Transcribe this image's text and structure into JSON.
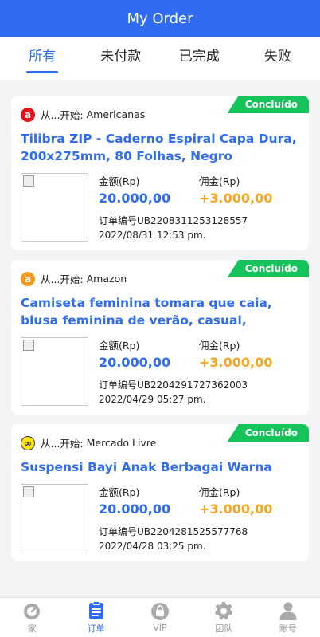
{
  "header": {
    "title": "My Order"
  },
  "tabs": [
    {
      "label": "所有"
    },
    {
      "label": "未付款"
    },
    {
      "label": "已完成"
    },
    {
      "label": "失败"
    }
  ],
  "orders": [
    {
      "status": "Concluído",
      "source_prefix": "从...开始:",
      "source": "Americanas",
      "source_icon": "americanas-icon",
      "source_icon_char": "a",
      "source_color": "#e3141b",
      "title": "Tilibra ZIP - Caderno Espiral Capa Dura, 200x275mm, 80 Folhas, Negro",
      "amount_label": "金额(Rp)",
      "amount": "20.000,00",
      "commission_label": "佣金(Rp)",
      "commission": "+3.000,00",
      "order_no": "订单编号UB2208311253128557",
      "date": "2022/08/31 12:53 pm."
    },
    {
      "status": "Concluído",
      "source_prefix": "从...开始:",
      "source": "Amazon",
      "source_icon": "amazon-icon",
      "source_icon_char": "a",
      "source_color": "#f39a1f",
      "title": "Camiseta feminina tomara que caia, blusa feminina de verão, casual, estampa…",
      "amount_label": "金额(Rp)",
      "amount": "20.000,00",
      "commission_label": "佣金(Rp)",
      "commission": "+3.000,00",
      "order_no": "订单编号UB2204291727362003",
      "date": "2022/04/29 05:27 pm."
    },
    {
      "status": "Concluído",
      "source_prefix": "从...开始:",
      "source": "Mercado Livre",
      "source_icon": "mercado-livre-icon",
      "source_icon_char": "∞",
      "source_color": "#ffe600",
      "title": "Suspensi Bayi Anak Berbagai Warna",
      "amount_label": "金额(Rp)",
      "amount": "20.000,00",
      "commission_label": "佣金(Rp)",
      "commission": "+3.000,00",
      "order_no": "订单编号UB2204281525577768",
      "date": "2022/04/28 03:25 pm."
    }
  ],
  "tabbar": [
    {
      "label": "家",
      "icon": "home-icon"
    },
    {
      "label": "订单",
      "icon": "orders-icon"
    },
    {
      "label": "VIP",
      "icon": "vip-icon"
    },
    {
      "label": "团队",
      "icon": "team-icon"
    },
    {
      "label": "账号",
      "icon": "account-icon"
    }
  ],
  "colors": {
    "primary": "#2f6cf0",
    "success": "#14c45a",
    "commission": "#f5a623"
  }
}
